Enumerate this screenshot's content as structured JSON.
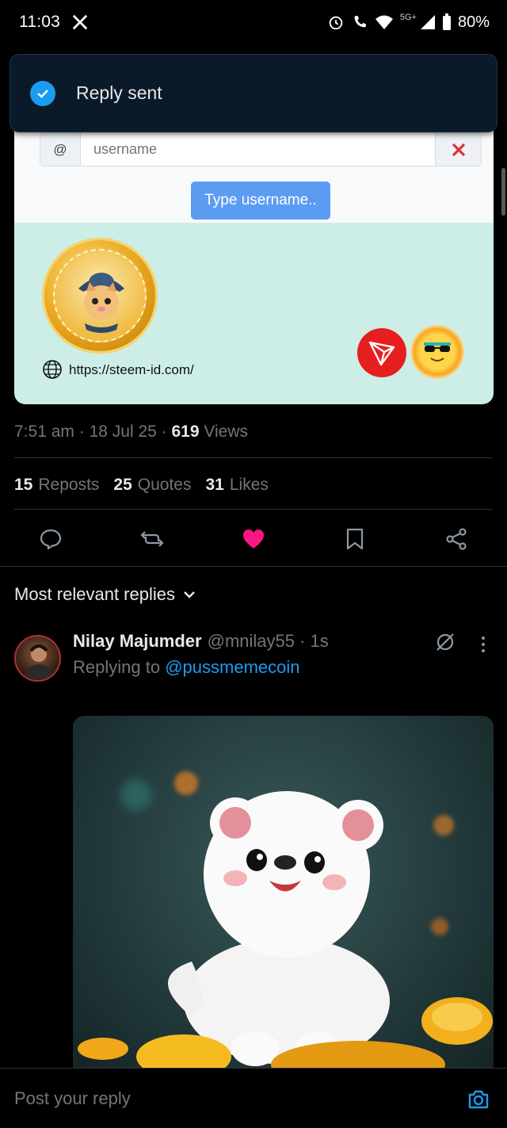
{
  "status_bar": {
    "time": "11:03",
    "network": "5G+",
    "battery": "80%"
  },
  "toast": {
    "message": "Reply sent"
  },
  "card": {
    "at_symbol": "@",
    "input_placeholder": "username",
    "button_label": "Type username..",
    "link_text": "https://steem-id.com/"
  },
  "post_meta": {
    "time": "7:51 am",
    "date": "18 Jul 25",
    "views_count": "619",
    "views_label": "Views",
    "sep": "·"
  },
  "stats": [
    {
      "count": "15",
      "label": "Reposts"
    },
    {
      "count": "25",
      "label": "Quotes"
    },
    {
      "count": "31",
      "label": "Likes"
    }
  ],
  "sort": {
    "label": "Most relevant replies"
  },
  "reply": {
    "name": "Nilay Majumder",
    "handle": "@mnilay55 · 1s",
    "replying_prefix": "Replying to",
    "replying_to": "@pussmemecoin"
  },
  "compose": {
    "placeholder": "Post your reply"
  },
  "colors": {
    "accent": "#1d9bf0",
    "like": "#f91880",
    "background": "#000000",
    "toast_bg": "#0b1a29"
  }
}
